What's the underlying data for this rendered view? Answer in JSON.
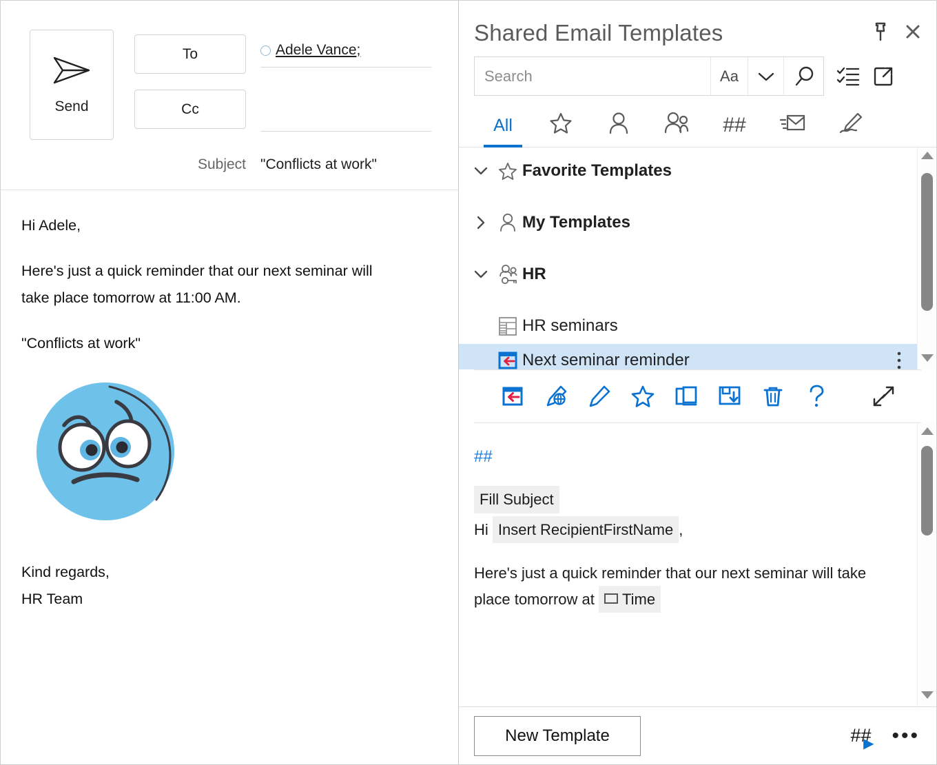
{
  "compose": {
    "send_label": "Send",
    "send_icon": "paper-plane-icon",
    "to_label": "To",
    "cc_label": "Cc",
    "subject_label": "Subject",
    "subject_value": "\"Conflicts at work\"",
    "recipient": "Adele Vance;",
    "cc_value": "",
    "body": {
      "greeting": "Hi Adele,",
      "paragraph": "Here's just a quick reminder that our next seminar will take place tomorrow at 11:00 AM.",
      "quote": "\"Conflicts at work\"",
      "image_alt": "worried-face-emoji",
      "signoff": "Kind regards,",
      "signature": "HR Team"
    }
  },
  "panel": {
    "title": "Shared Email Templates",
    "pin_icon": "pin-icon",
    "close_icon": "close-icon",
    "search": {
      "placeholder": "Search",
      "value": "",
      "match_case_label": "Aa",
      "chevron_icon": "chevron-down-icon",
      "search_icon": "magnifier-icon"
    },
    "header_tools": [
      {
        "name": "checklist-icon"
      },
      {
        "name": "open-external-icon"
      }
    ],
    "tabs": [
      {
        "label": "All",
        "icon": "",
        "active": true
      },
      {
        "label": "",
        "icon": "star-icon",
        "active": false
      },
      {
        "label": "",
        "icon": "person-icon",
        "active": false
      },
      {
        "label": "",
        "icon": "people-icon",
        "active": false
      },
      {
        "label": "##",
        "icon": "hashtag-icon",
        "active": false
      },
      {
        "label": "",
        "icon": "envelope-lines-icon",
        "active": false
      },
      {
        "label": "",
        "icon": "signature-pen-icon",
        "active": false
      }
    ],
    "tree": [
      {
        "label": "Favorite Templates",
        "icon": "star-icon",
        "twisty": "expanded",
        "level": "group",
        "selected": false
      },
      {
        "label": "My Templates",
        "icon": "person-icon",
        "twisty": "collapsed",
        "level": "group",
        "selected": false
      },
      {
        "label": "HR",
        "icon": "team-key-icon",
        "twisty": "expanded",
        "level": "group",
        "selected": false
      },
      {
        "label": "HR seminars",
        "icon": "folder-table-icon",
        "twisty": "none",
        "level": "child",
        "selected": false
      },
      {
        "label": "Next seminar reminder",
        "icon": "insert-template-icon",
        "twisty": "none",
        "level": "child",
        "selected": true
      }
    ],
    "toolbar": [
      {
        "name": "insert-template-icon",
        "label": "Paste template"
      },
      {
        "name": "edit-html-icon",
        "label": "Edit in HTML editor"
      },
      {
        "name": "edit-pencil-icon",
        "label": "Edit template"
      },
      {
        "name": "favorite-star-icon",
        "label": "Add to favorites"
      },
      {
        "name": "duplicate-icon",
        "label": "Duplicate"
      },
      {
        "name": "save-to-icon",
        "label": "Save to"
      },
      {
        "name": "delete-trash-icon",
        "label": "Delete"
      },
      {
        "name": "help-question-icon",
        "label": "Help"
      },
      {
        "name": "expand-diagonal-icon",
        "label": "Expand"
      }
    ],
    "preview": {
      "hashmark": "##",
      "fill_subject_chip": "Fill Subject",
      "greeting_prefix": "Hi",
      "recipient_chip": "Insert RecipientFirstName",
      "greeting_suffix": ",",
      "body_text_1": "Here's just a quick reminder that our next seminar will take place tomorrow at",
      "time_chip": "Time"
    },
    "bottom": {
      "new_template_label": "New Template",
      "hash_run_label": "##",
      "play_icon": "play-icon",
      "more_icon": "ellipsis-icon"
    },
    "colors": {
      "accent": "#0a72d1",
      "selection": "#cfe4f7",
      "hash_blue": "#1d7ddb",
      "red_arrow": "#e02040",
      "emoji_blue": "#6ec1e8"
    }
  }
}
